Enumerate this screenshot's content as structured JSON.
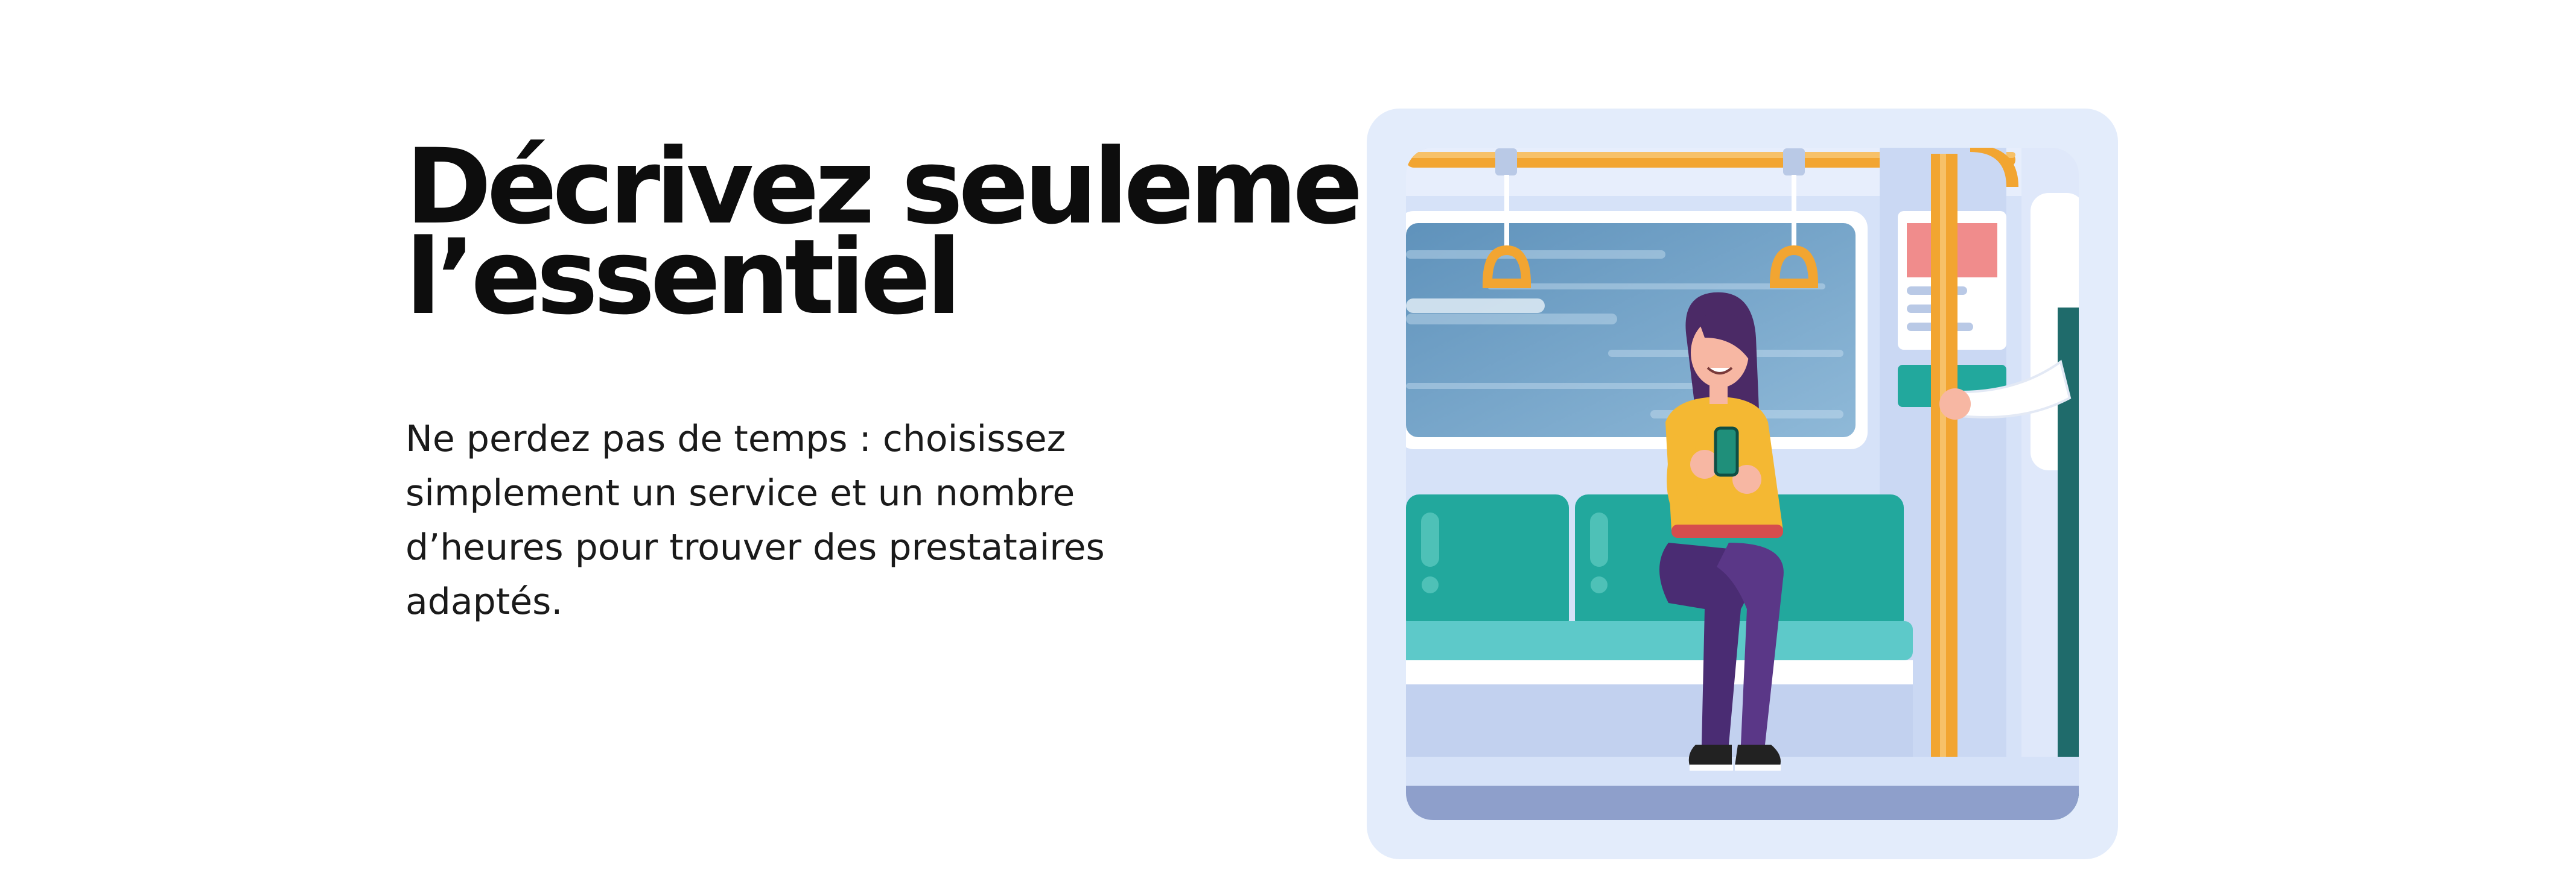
{
  "section": {
    "heading_line1": "Décrivez seulement",
    "heading_line2": "l’essentiel",
    "description": "Ne perdez pas de temps : choisissez simplement un service et un nombre d’heures pour trouver des prestataires adaptés."
  },
  "illustration": {
    "icon": "subway-passenger-illustration",
    "colors": {
      "frame": "#e3ecfb",
      "wall": "#d6e2f8",
      "window_glass": "#6f9fc4",
      "rail": "#f2a531",
      "seat": "#22a89d",
      "seat_front": "#5dc9c9",
      "floor": "#8e9fcb",
      "shirt": "#f4b833",
      "pants": "#4a2c73",
      "hair": "#4b2a66"
    }
  }
}
